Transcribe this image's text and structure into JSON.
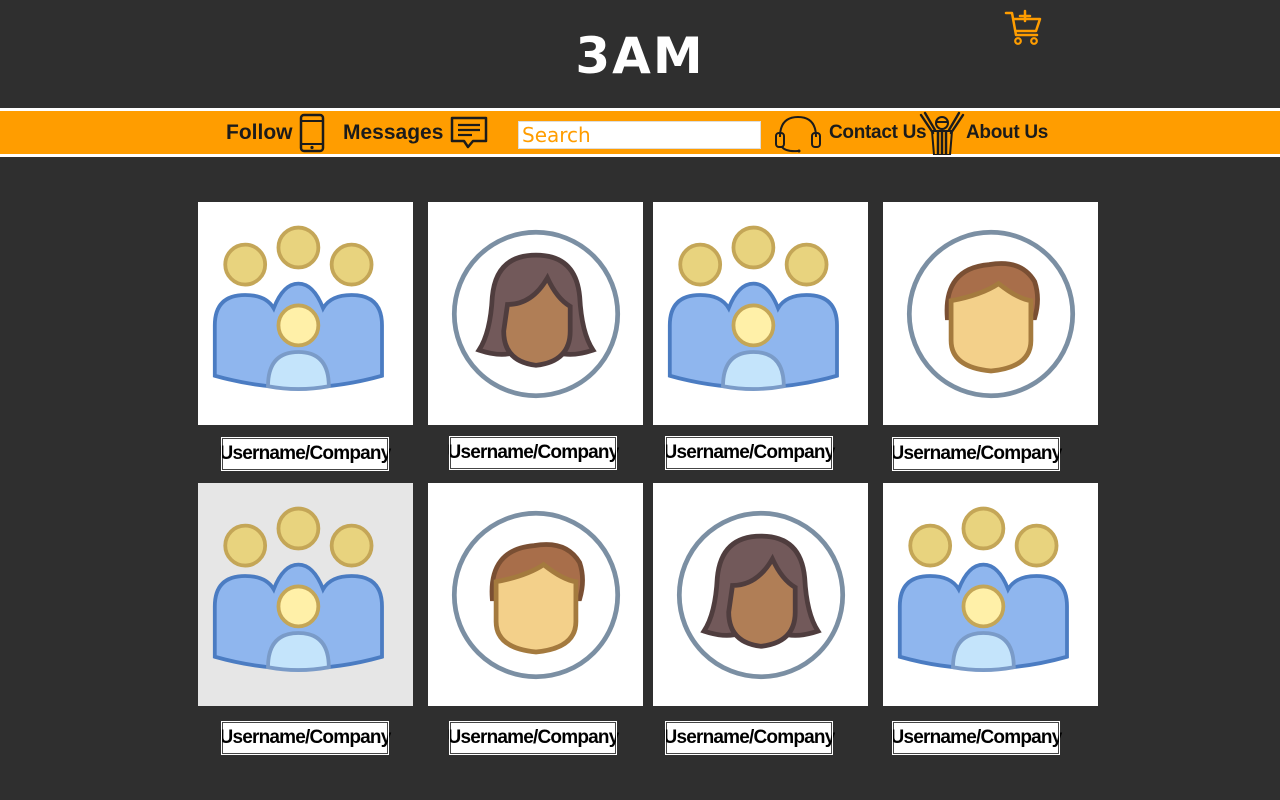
{
  "app": {
    "logo": "3AM"
  },
  "header": {
    "cart_icon": "cart-plus-icon"
  },
  "nav": {
    "follow_label": "Follow",
    "follow_icon": "smartphone-icon",
    "messages_label": "Messages",
    "messages_icon": "message-icon",
    "search_placeholder": "Search",
    "contact_label": "Contact Us",
    "contact_icon": "headset-icon",
    "about_label": "About Us",
    "about_icon": "referee-icon"
  },
  "colors": {
    "background": "#2f2f2f",
    "accent": "#ff9d00",
    "card": "#ffffff",
    "card_selected": "#e6e6e6"
  },
  "profiles": [
    {
      "label": "Username/Company",
      "avatar": "group-icon"
    },
    {
      "label": "Username/Company",
      "avatar": "woman-avatar-icon"
    },
    {
      "label": "Username/Company",
      "avatar": "group-icon"
    },
    {
      "label": "Username/Company",
      "avatar": "man-avatar-icon"
    },
    {
      "label": "Username/Company",
      "avatar": "group-icon",
      "selected": true
    },
    {
      "label": "Username/Company",
      "avatar": "man-avatar-icon"
    },
    {
      "label": "Username/Company",
      "avatar": "woman-avatar-icon"
    },
    {
      "label": "Username/Company",
      "avatar": "group-icon"
    }
  ]
}
